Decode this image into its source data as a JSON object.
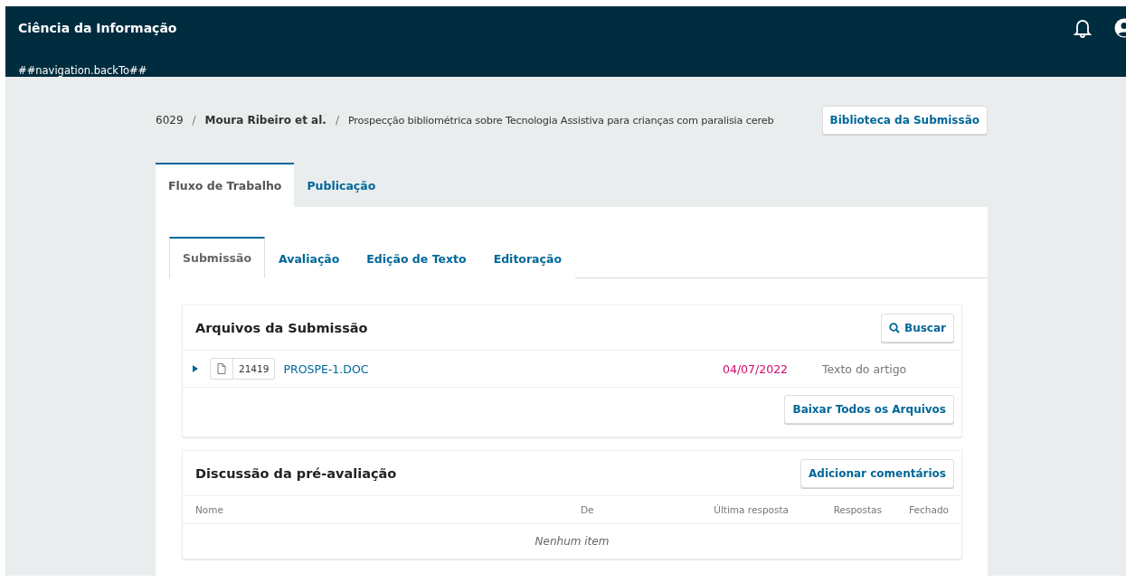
{
  "header": {
    "site_title": "Ciência da Informação",
    "back_link": "##navigation.backTo##"
  },
  "breadcrumb": {
    "separators": [
      "/",
      "/"
    ],
    "id": "6029",
    "authors": "Moura Ribeiro et al.",
    "title": "Prospecção bibliométrica sobre Tecnologia Assistiva para crianças com paralisia cereb",
    "library_button": "Biblioteca da Submissão"
  },
  "tabs": [
    {
      "label": "Fluxo de Trabalho",
      "selected": true
    },
    {
      "label": "Publicação",
      "selected": false
    }
  ],
  "stage_tabs": [
    {
      "label": "Submissão",
      "selected": true
    },
    {
      "label": "Avaliação",
      "selected": false
    },
    {
      "label": "Edição de Texto",
      "selected": false
    },
    {
      "label": "Editoração",
      "selected": false
    }
  ],
  "files_panel": {
    "title": "Arquivos da Submissão",
    "search_button": "Buscar",
    "files": [
      {
        "id": "21419",
        "name": "PROSPE-1.DOC",
        "date": "04/07/2022",
        "type": "Texto do artigo",
        "expanded": false
      }
    ],
    "download_button": "Baixar Todos os Arquivos"
  },
  "discussion_panel": {
    "title": "Discussão da pré-avaliação",
    "add_button": "Adicionar comentários",
    "columns": [
      "Nome",
      "De",
      "Última resposta",
      "Respostas",
      "Fechado"
    ],
    "empty_text": "Nenhum item"
  }
}
